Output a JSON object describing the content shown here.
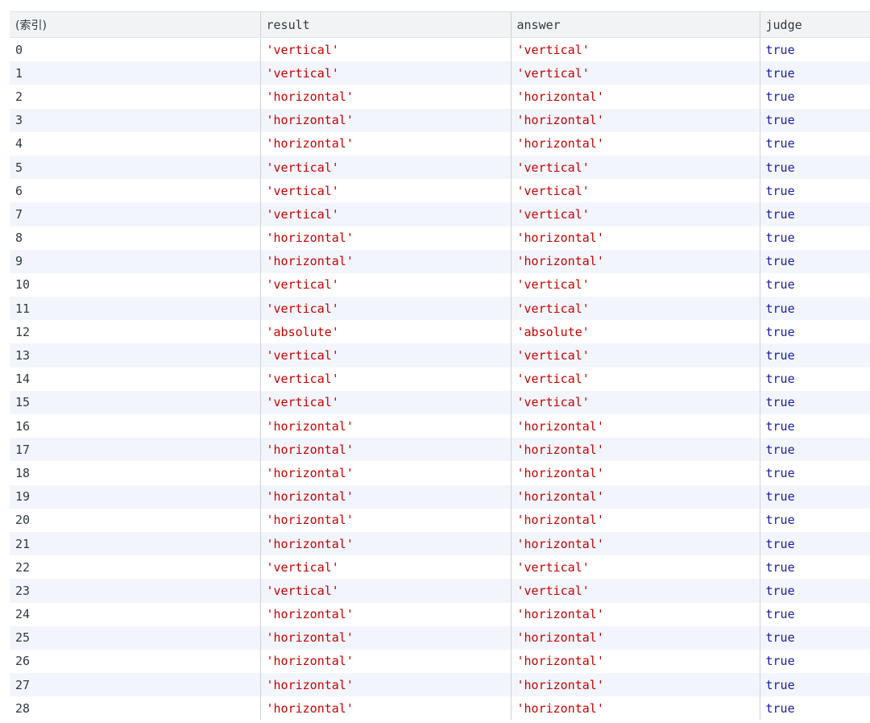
{
  "table": {
    "columns": [
      "(索引)",
      "result",
      "answer",
      "judge"
    ],
    "rows": [
      {
        "index": "0",
        "result": "'vertical'",
        "answer": "'vertical'",
        "judge": "true"
      },
      {
        "index": "1",
        "result": "'vertical'",
        "answer": "'vertical'",
        "judge": "true"
      },
      {
        "index": "2",
        "result": "'horizontal'",
        "answer": "'horizontal'",
        "judge": "true"
      },
      {
        "index": "3",
        "result": "'horizontal'",
        "answer": "'horizontal'",
        "judge": "true"
      },
      {
        "index": "4",
        "result": "'horizontal'",
        "answer": "'horizontal'",
        "judge": "true"
      },
      {
        "index": "5",
        "result": "'vertical'",
        "answer": "'vertical'",
        "judge": "true"
      },
      {
        "index": "6",
        "result": "'vertical'",
        "answer": "'vertical'",
        "judge": "true"
      },
      {
        "index": "7",
        "result": "'vertical'",
        "answer": "'vertical'",
        "judge": "true"
      },
      {
        "index": "8",
        "result": "'horizontal'",
        "answer": "'horizontal'",
        "judge": "true"
      },
      {
        "index": "9",
        "result": "'horizontal'",
        "answer": "'horizontal'",
        "judge": "true"
      },
      {
        "index": "10",
        "result": "'vertical'",
        "answer": "'vertical'",
        "judge": "true"
      },
      {
        "index": "11",
        "result": "'vertical'",
        "answer": "'vertical'",
        "judge": "true"
      },
      {
        "index": "12",
        "result": "'absolute'",
        "answer": "'absolute'",
        "judge": "true"
      },
      {
        "index": "13",
        "result": "'vertical'",
        "answer": "'vertical'",
        "judge": "true"
      },
      {
        "index": "14",
        "result": "'vertical'",
        "answer": "'vertical'",
        "judge": "true"
      },
      {
        "index": "15",
        "result": "'vertical'",
        "answer": "'vertical'",
        "judge": "true"
      },
      {
        "index": "16",
        "result": "'horizontal'",
        "answer": "'horizontal'",
        "judge": "true"
      },
      {
        "index": "17",
        "result": "'horizontal'",
        "answer": "'horizontal'",
        "judge": "true"
      },
      {
        "index": "18",
        "result": "'horizontal'",
        "answer": "'horizontal'",
        "judge": "true"
      },
      {
        "index": "19",
        "result": "'horizontal'",
        "answer": "'horizontal'",
        "judge": "true"
      },
      {
        "index": "20",
        "result": "'horizontal'",
        "answer": "'horizontal'",
        "judge": "true"
      },
      {
        "index": "21",
        "result": "'horizontal'",
        "answer": "'horizontal'",
        "judge": "true"
      },
      {
        "index": "22",
        "result": "'vertical'",
        "answer": "'vertical'",
        "judge": "true"
      },
      {
        "index": "23",
        "result": "'vertical'",
        "answer": "'vertical'",
        "judge": "true"
      },
      {
        "index": "24",
        "result": "'horizontal'",
        "answer": "'horizontal'",
        "judge": "true"
      },
      {
        "index": "25",
        "result": "'horizontal'",
        "answer": "'horizontal'",
        "judge": "true"
      },
      {
        "index": "26",
        "result": "'horizontal'",
        "answer": "'horizontal'",
        "judge": "true"
      },
      {
        "index": "27",
        "result": "'horizontal'",
        "answer": "'horizontal'",
        "judge": "true"
      },
      {
        "index": "28",
        "result": "'horizontal'",
        "answer": "'horizontal'",
        "judge": "true"
      }
    ]
  },
  "colors": {
    "string": "#c80000",
    "boolean": "#1a1aa6",
    "header_bg": "#f1f3f4",
    "stripe_bg": "#f2f6fc"
  }
}
